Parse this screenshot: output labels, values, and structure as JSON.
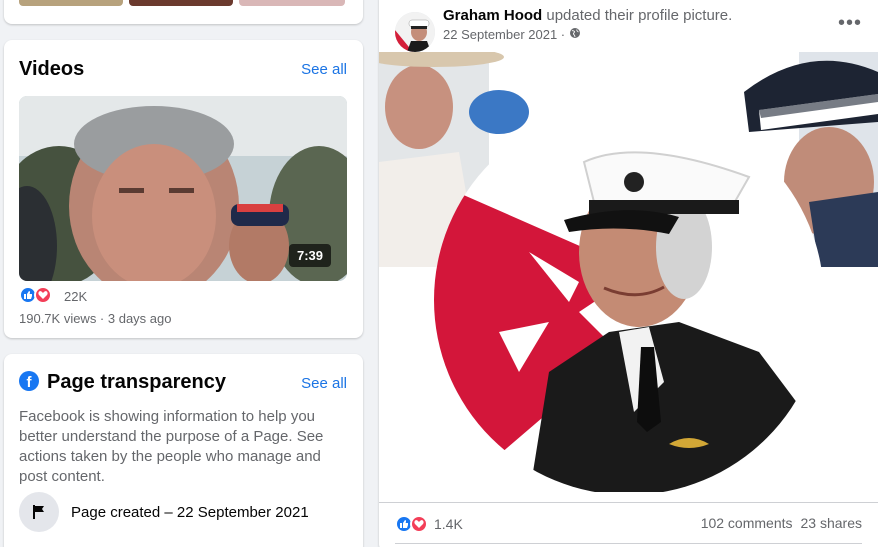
{
  "videos": {
    "title": "Videos",
    "see_all": "See all",
    "duration": "7:39",
    "reactions_count": "22K",
    "views_line": "190.7K views · 3 days ago"
  },
  "transparency": {
    "title": "Page transparency",
    "see_all": "See all",
    "description": "Facebook is showing information to help you better understand the purpose of a Page. See actions taken by the people who manage and post content.",
    "page_created": "Page created – 22 September 2021"
  },
  "post": {
    "author": "Graham Hood",
    "action": " updated their profile picture.",
    "time": "22 September 2021 ·",
    "reactions_count": "1.4K",
    "comments": "102 comments",
    "shares": "23 shares"
  },
  "icons": {
    "reaction_like": "like-icon",
    "reaction_love": "love-icon",
    "privacy": "globe-icon",
    "flag": "flag-icon",
    "more": "more-icon"
  },
  "colors": {
    "accent": "#1b74e4",
    "facebook_blue": "#1877f2",
    "love_red": "#f33e58"
  }
}
